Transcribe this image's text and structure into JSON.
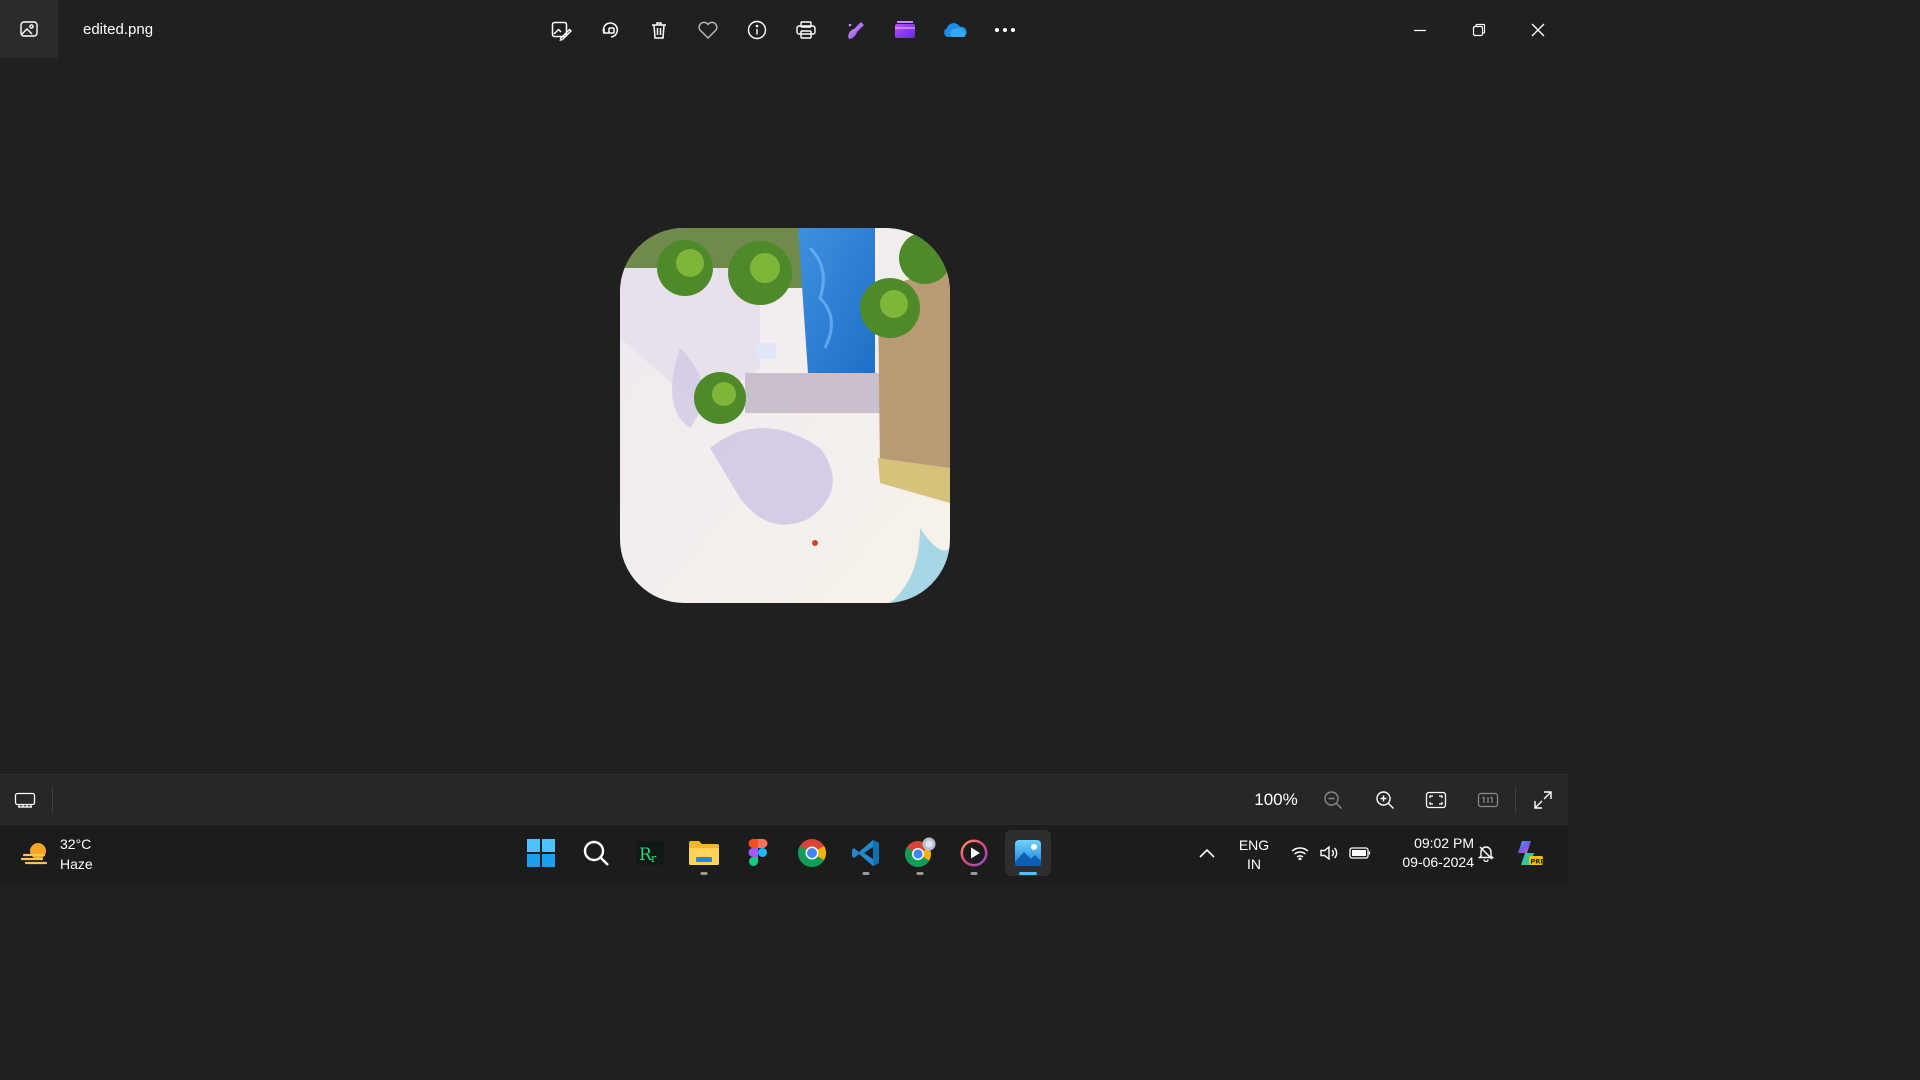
{
  "window": {
    "filename": "edited.png"
  },
  "toolbar": {
    "items": [
      {
        "name": "edit-image-icon"
      },
      {
        "name": "rotate-icon"
      },
      {
        "name": "delete-icon"
      },
      {
        "name": "favorite-icon"
      },
      {
        "name": "info-icon"
      },
      {
        "name": "print-icon"
      },
      {
        "name": "designer-icon"
      },
      {
        "name": "clipchamp-icon"
      },
      {
        "name": "onedrive-icon"
      },
      {
        "name": "more-icon"
      }
    ]
  },
  "statusbar": {
    "zoom_label": "100%"
  },
  "taskbar": {
    "weather_temp": "32°C",
    "weather_desc": "Haze",
    "language_line1": "ENG",
    "language_line2": "IN",
    "time": "09:02 PM",
    "date": "09-06-2024"
  },
  "colors": {
    "background": "#202020",
    "accent": "#4cc2ff",
    "taskbar": "#1c1c1c"
  }
}
